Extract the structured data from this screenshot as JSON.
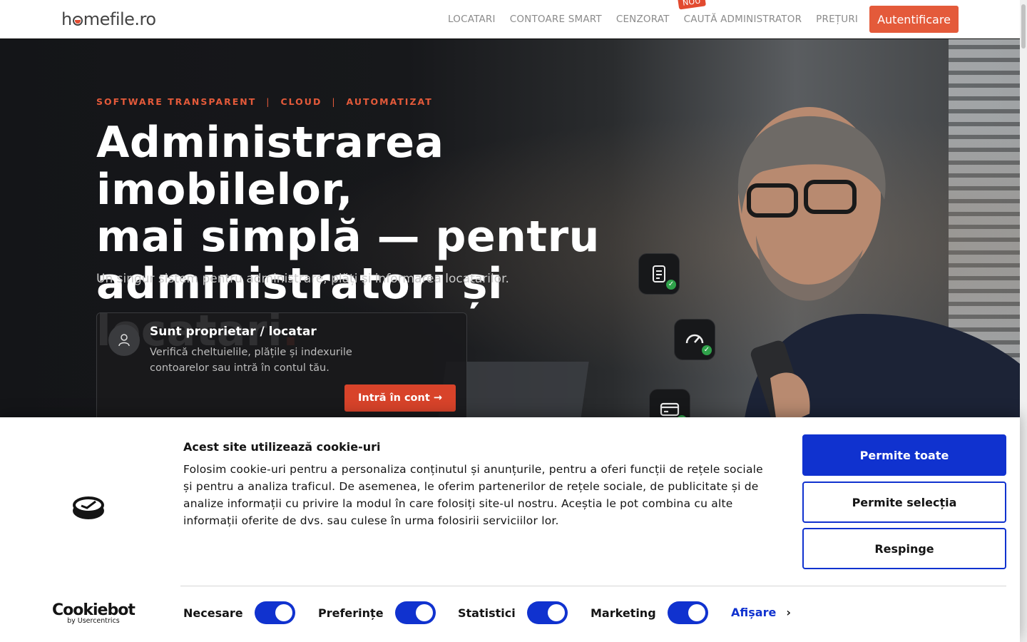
{
  "header": {
    "logo_text_1": "h",
    "logo_text_2": "mefile.ro",
    "nav": [
      {
        "label": "LOCATARI"
      },
      {
        "label": "CONTOARE SMART"
      },
      {
        "label": "CENZORAT"
      },
      {
        "label": "CAUTĂ ADMINISTRATOR",
        "badge": "NOU"
      },
      {
        "label": "PREȚURI"
      }
    ],
    "login_label": "Autentificare"
  },
  "hero": {
    "tagline": [
      "SOFTWARE TRANSPARENT",
      "CLOUD",
      "AUTOMATIZAT"
    ],
    "tagline_sep": "|",
    "headline_line1": "Administrarea imobilelor,",
    "headline_line2": "mai simplă — pentru",
    "headline_line3": "administratori și locatari",
    "headline_dot": ".",
    "subline": "Un singur sistem pentru administrare, plăți și informarea locatarilor.",
    "card": {
      "title": "Sunt proprietar / locatar",
      "text": "Verifică cheltuielile, plățile și indexurile contoarelor sau intră în contul tău.",
      "cta": "Intră în cont",
      "cta_icon": "→"
    },
    "chips": [
      "document-check-icon",
      "meter-check-icon",
      "card-check-icon"
    ],
    "accent": "#e24a2f"
  },
  "cookie": {
    "title": "Acest site utilizează cookie-uri",
    "body": "Folosim cookie-uri pentru a personaliza conținutul și anunțurile, pentru a oferi funcții de rețele sociale și pentru a analiza traficul. De asemenea, le oferim partenerilor de rețele sociale, de publicitate și de analize informații cu privire la modul în care folosiți site-ul nostru. Aceștia le pot combina cu alte informații oferite de dvs. sau culese în urma folosirii serviciilor lor.",
    "allow_all": "Permite toate",
    "allow_selection": "Permite selecția",
    "reject": "Respinge",
    "brand": "Cookiebot",
    "brand_by": "by Usercentrics",
    "toggles": [
      {
        "label": "Necesare",
        "on": true
      },
      {
        "label": "Preferințe",
        "on": true
      },
      {
        "label": "Statistici",
        "on": true
      },
      {
        "label": "Marketing",
        "on": true
      }
    ],
    "details_label": "Afișare",
    "accent": "#1032cf"
  }
}
